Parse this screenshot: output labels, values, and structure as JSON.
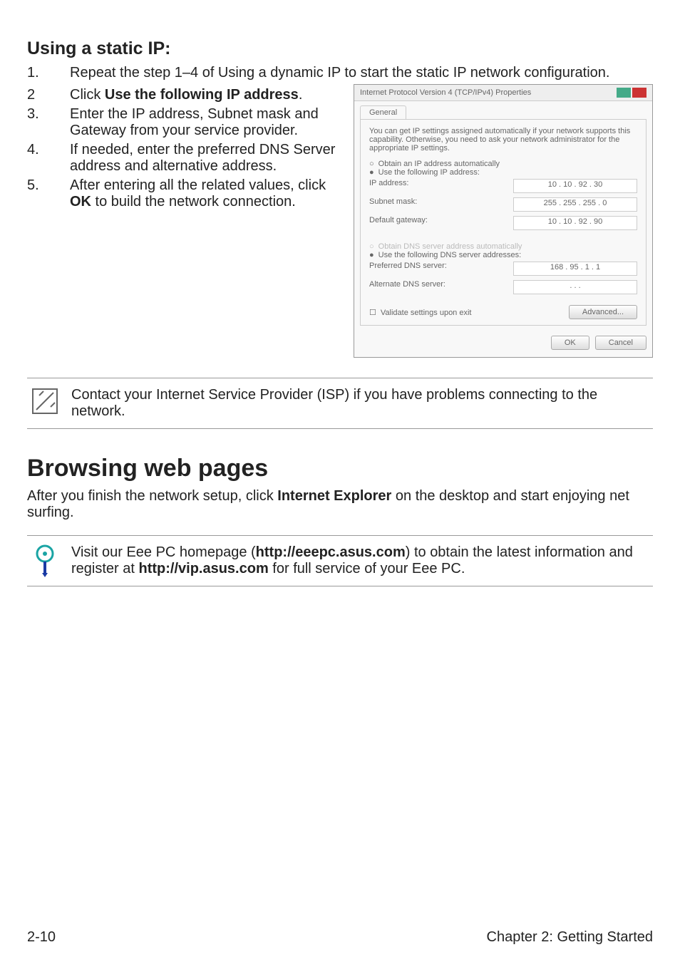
{
  "section_title": "Using a static IP:",
  "steps": [
    {
      "num": "1.",
      "text_pre": "Repeat the step 1–4 of Using a dynamic IP to start the static IP network configuration."
    },
    {
      "num": "2",
      "text_pre": "Click ",
      "bold": "Use the following IP address",
      "text_post": "."
    },
    {
      "num": "3.",
      "text_pre": "Enter the IP address, Subnet mask and Gateway from your service provider."
    },
    {
      "num": "4.",
      "text_pre": "If needed, enter the preferred DNS Server address and alternative address."
    },
    {
      "num": "5.",
      "text_pre": "After entering all the related values, click ",
      "bold": "OK",
      "text_post": " to build the network connection."
    }
  ],
  "dialog": {
    "title": "Internet Protocol Version 4 (TCP/IPv4) Properties",
    "tab": "General",
    "desc": "You can get IP settings assigned automatically if your network supports this capability. Otherwise, you need to ask your network administrator for the appropriate IP settings.",
    "radio_auto_ip": "Obtain an IP address automatically",
    "radio_use_ip": "Use the following IP address:",
    "lbl_ip": "IP address:",
    "val_ip": "10 . 10 . 92 . 30",
    "lbl_mask": "Subnet mask:",
    "val_mask": "255 . 255 . 255 . 0",
    "lbl_gw": "Default gateway:",
    "val_gw": "10 . 10 . 92 . 90",
    "radio_auto_dns": "Obtain DNS server address automatically",
    "radio_use_dns": "Use the following DNS server addresses:",
    "lbl_pref": "Preferred DNS server:",
    "val_pref": "168 . 95 . 1 . 1",
    "lbl_alt": "Alternate DNS server:",
    "val_alt": ".   .   .",
    "chk_validate": "Validate settings upon exit",
    "btn_adv": "Advanced...",
    "btn_ok": "OK",
    "btn_cancel": "Cancel"
  },
  "note_text": "Contact your Internet Service Provider (ISP) if you have problems connecting to the network.",
  "heading2": "Browsing web pages",
  "body2_pre": "After you finish the network setup, click ",
  "body2_bold": "Internet Explorer",
  "body2_post": " on the desktop and start enjoying net surfing.",
  "tip_pre": "Visit our Eee PC homepage (",
  "tip_link1": "http://eeepc.asus.com",
  "tip_mid": ") to obtain the latest information and register at ",
  "tip_link2": "http://vip.asus.com",
  "tip_post": " for full service of your Eee PC.",
  "footer_left": "2-10",
  "footer_right": "Chapter 2: Getting Started"
}
